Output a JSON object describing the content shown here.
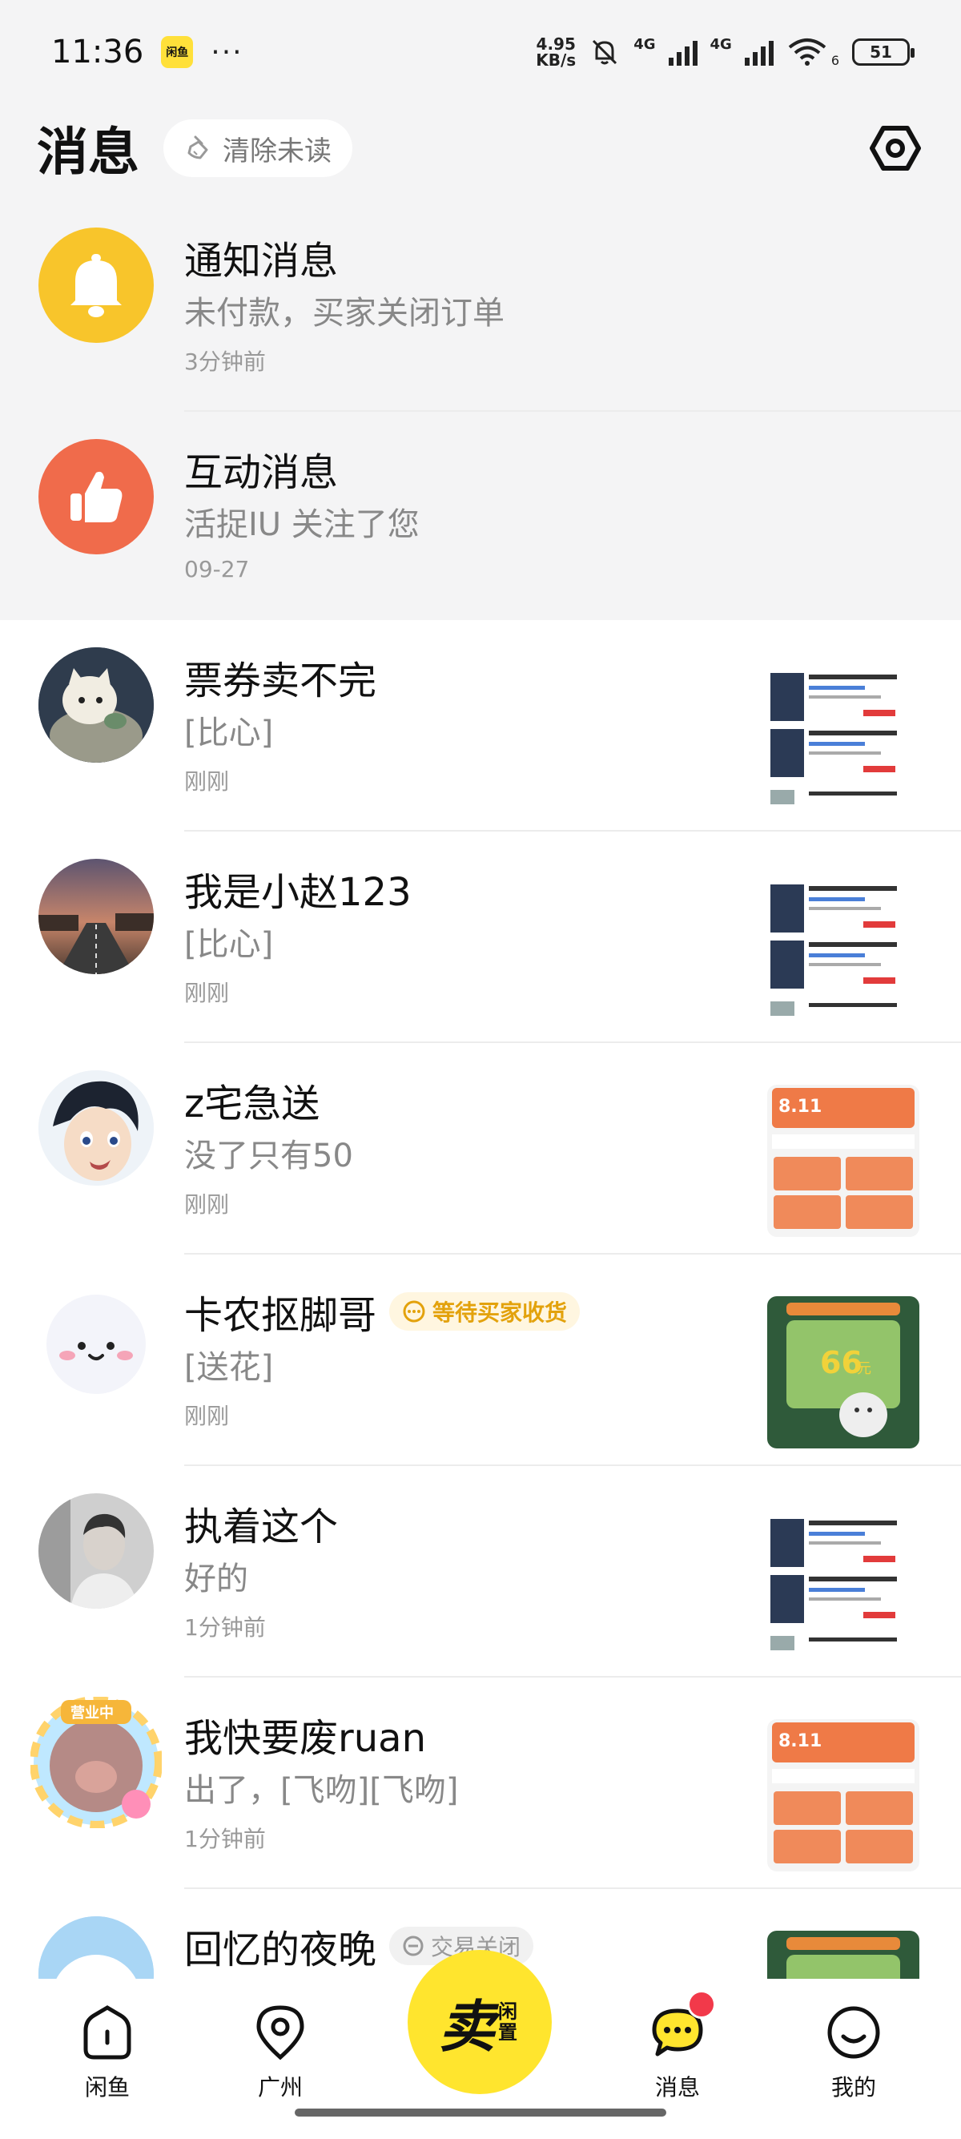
{
  "status_bar": {
    "time": "11:36",
    "app_icon": "闲鱼",
    "more": "···",
    "speed_value": "4.95",
    "speed_unit": "KB/s",
    "net1": "4G",
    "net2": "4G",
    "wifi_label": "6",
    "battery": "51"
  },
  "header": {
    "title": "消息",
    "clear_unread_label": "清除未读",
    "settings_icon": "gear-icon"
  },
  "system_messages": [
    {
      "name": "通知消息",
      "preview": "未付款，买家关闭订单",
      "time": "3分钟前",
      "icon": "bell-icon",
      "color": "#f8c52b"
    },
    {
      "name": "互动消息",
      "preview": "活捉IU 关注了您",
      "time": "09-27",
      "icon": "thumbs-up-icon",
      "color": "#f06b4b"
    }
  ],
  "conversations": [
    {
      "name": "票券卖不完",
      "preview": "[比心]",
      "time": "刚刚",
      "badge": "",
      "thumb": "hotel-listing"
    },
    {
      "name": "我是小赵123",
      "preview": "[比心]",
      "time": "刚刚",
      "badge": "",
      "thumb": "hotel-listing"
    },
    {
      "name": "z宅急送",
      "preview": "没了只有50",
      "time": "刚刚",
      "badge": "",
      "thumb": "orange-coupon"
    },
    {
      "name": "卡农抠脚哥",
      "preview": "[送花]",
      "time": "刚刚",
      "badge": "等待买家收货",
      "badge_type": "wait",
      "thumb": "green-coupon"
    },
    {
      "name": "执着这个",
      "preview": "好的",
      "time": "1分钟前",
      "badge": "",
      "thumb": "hotel-listing"
    },
    {
      "name": "我快要废ruan",
      "preview": "出了，[飞吻][飞吻]",
      "time": "1分钟前",
      "badge": "",
      "avatar_badge": "营业中",
      "thumb": "orange-coupon"
    },
    {
      "name": "回忆的夜晚",
      "preview": "",
      "time": "",
      "badge": "交易关闭",
      "badge_type": "closed",
      "thumb": "green-coupon"
    }
  ],
  "thumb_text": {
    "coupon_date": "8.11",
    "coupon_amount": "66",
    "coupon_unit": "元"
  },
  "bottom_nav": {
    "home": "闲鱼",
    "city": "广州",
    "sell_main": "卖",
    "sell_sub": "闲置",
    "messages": "消息",
    "profile": "我的"
  },
  "colors": {
    "accent_yellow": "#ffe52e",
    "badge_red": "#f2394a",
    "wait_badge_text": "#e3a20c"
  }
}
